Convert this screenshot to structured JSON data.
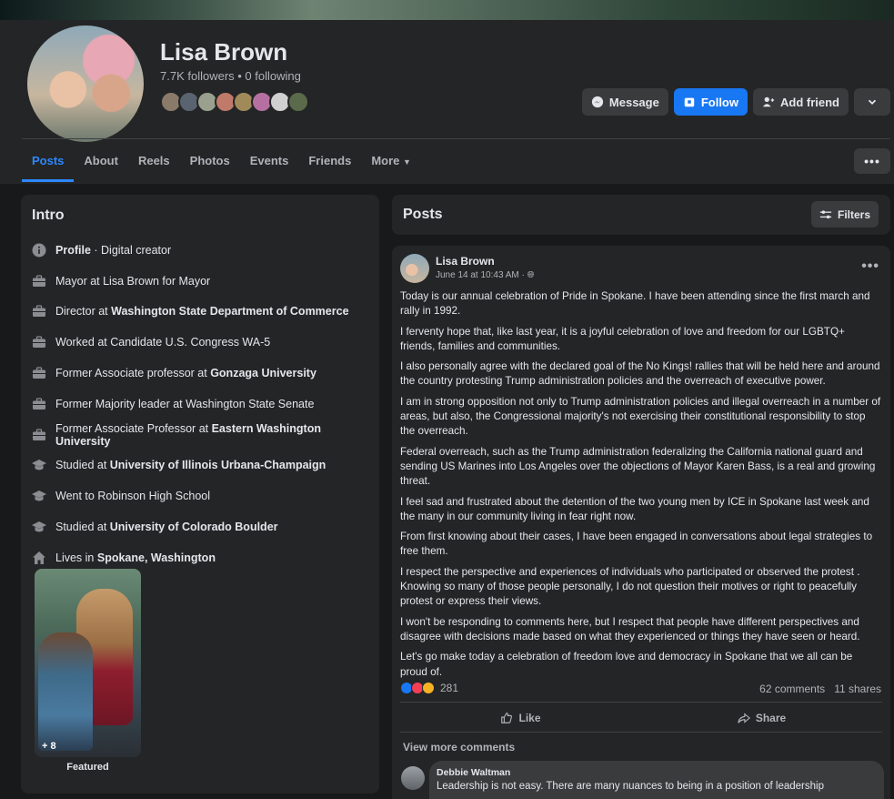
{
  "profile": {
    "name": "Lisa Brown",
    "followers": "7.7K followers • 0 following"
  },
  "actions": {
    "message": "Message",
    "follow": "Follow",
    "add_friend": "Add friend"
  },
  "tabs": [
    {
      "label": "Posts"
    },
    {
      "label": "About"
    },
    {
      "label": "Reels"
    },
    {
      "label": "Photos"
    },
    {
      "label": "Events"
    },
    {
      "label": "Friends"
    },
    {
      "label": "More"
    }
  ],
  "intro": {
    "title": "Intro",
    "items": [
      {
        "icon": "info-icon",
        "bold": "Profile",
        "pre": "",
        "post": " · Digital creator"
      },
      {
        "icon": "briefcase-icon",
        "pre": "Mayor at Lisa Brown for Mayor",
        "bold": "",
        "post": ""
      },
      {
        "icon": "briefcase-icon",
        "pre": "Director at ",
        "bold": "Washington State Department of Commerce",
        "post": ""
      },
      {
        "icon": "briefcase-icon",
        "pre": "Worked at Candidate U.S. Congress WA-5",
        "bold": "",
        "post": ""
      },
      {
        "icon": "briefcase-icon",
        "pre": "Former Associate professor at ",
        "bold": "Gonzaga University",
        "post": ""
      },
      {
        "icon": "briefcase-icon",
        "pre": "Former Majority leader at Washington State Senate",
        "bold": "",
        "post": ""
      },
      {
        "icon": "briefcase-icon",
        "pre": "Former Associate Professor at ",
        "bold": "Eastern Washington University",
        "post": ""
      },
      {
        "icon": "graduation-cap-icon",
        "pre": "Studied at ",
        "bold": "University of Illinois Urbana-Champaign",
        "post": ""
      },
      {
        "icon": "graduation-cap-icon",
        "pre": "Went to Robinson High School",
        "bold": "",
        "post": ""
      },
      {
        "icon": "graduation-cap-icon",
        "pre": "Studied at ",
        "bold": "University of Colorado Boulder",
        "post": ""
      },
      {
        "icon": "home-icon",
        "pre": "Lives in ",
        "bold": "Spokane, Washington",
        "post": ""
      }
    ],
    "featured_count": "+ 8",
    "featured_label": "Featured"
  },
  "posts_header": {
    "title": "Posts",
    "filters": "Filters"
  },
  "post": {
    "author": "Lisa Brown",
    "time": "June 14 at 10:43 AM · ",
    "paragraphs": [
      "Today is our annual celebration of Pride in  Spokane. I have been attending since the first march and rally in 1992.",
      "I ferventy hope that,  like last year,  it is a joyful celebration of love and freedom for our LGBTQ+ friends, families and communities.",
      "I also personally agree with the declared goal  of the No Kings!  rallies that will be held here  and around the country protesting Trump administration policies and the overreach of executive power.",
      "I am in strong opposition not only to  Trump administration policies and illegal overreach in a number of areas, but also, the Congressional majority's not exercising their constitutional responsibility to stop the overreach.",
      "Federal overreach, such as the Trump administration federalizing the California national guard and sending US Marines into Los Angeles over the objections of Mayor Karen Bass, is a real and growing threat.",
      "I feel sad and frustrated about the detention of the two young men by ICE in Spokane last week and the many in our community living in fear right now.",
      "From first knowing about their cases,  I have been engaged in conversations about legal strategies to free them.",
      "I respect the perspective and experiences of individuals who participated or observed the protest . Knowing so many of those people personally, I do not question their motives or right to peacefully protest or express their views.",
      "I won't be responding to comments here, but I respect that people have different perspectives and disagree with decisions made based on what they experienced or things they have seen or heard.",
      "Let's go make today a celebration of freedom love and democracy in Spokane that we all can be proud of."
    ],
    "reaction_count": "281",
    "comments": "62 comments",
    "shares": "11 shares",
    "like": "Like",
    "share": "Share",
    "view_more": "View more comments"
  },
  "comment": {
    "author": "Debbie Waltman",
    "text": "Leadership is not easy. There are many nuances to being in a position of leadership"
  },
  "colors": {
    "background": "#18191a",
    "card": "#242526",
    "accent": "#1877f2",
    "tab_active": "#2d88ff"
  }
}
